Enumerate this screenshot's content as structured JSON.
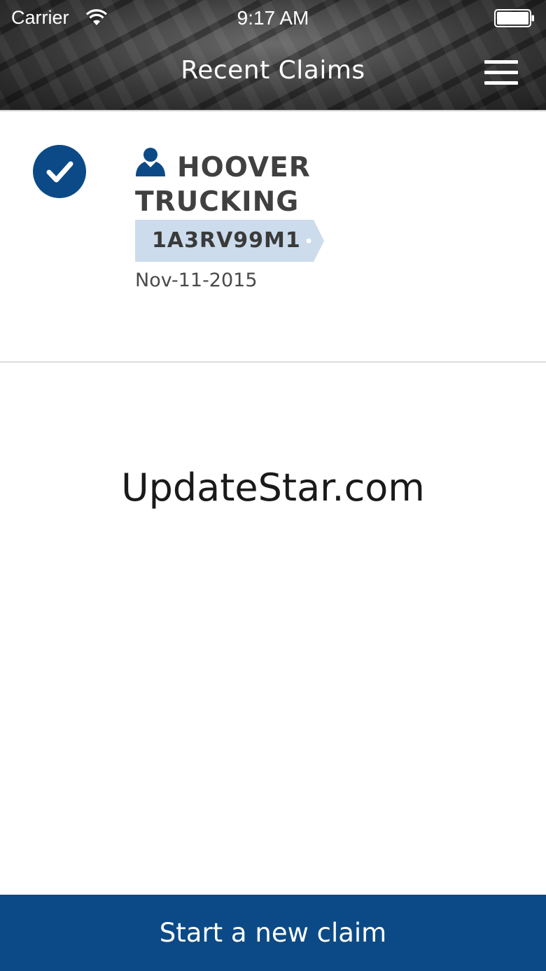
{
  "status_bar": {
    "carrier": "Carrier",
    "time": "9:17 AM",
    "wifi_icon": "wifi-icon",
    "battery_icon": "battery-icon"
  },
  "nav": {
    "title": "Recent Claims",
    "menu_icon": "hamburger-menu-icon"
  },
  "claims": [
    {
      "status_icon": "check-circle-icon",
      "owner_icon": "person-icon",
      "company": "HOOVER TRUCKING",
      "vin": "1A3RV99M1",
      "date": "Nov-11-2015"
    }
  ],
  "watermark": "UpdateStar.com",
  "footer": {
    "button_label": "Start a new claim"
  },
  "colors": {
    "brand_blue": "#0b4a87",
    "tag_bg": "#ccdcec",
    "text_dark": "#404040"
  }
}
